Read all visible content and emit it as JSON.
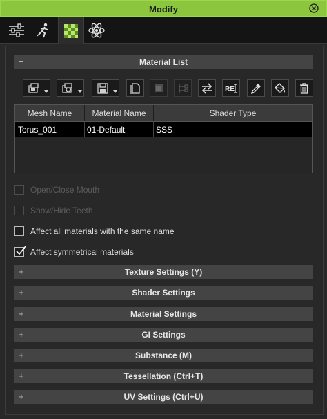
{
  "window": {
    "title": "Modify"
  },
  "tabs": [
    {
      "name": "modify-sliders-tab",
      "icon": "sliders-icon",
      "active": false
    },
    {
      "name": "motion-tab",
      "icon": "running-figure-icon",
      "active": false
    },
    {
      "name": "material-tab",
      "icon": "checker-material-icon",
      "active": true
    },
    {
      "name": "physics-tab",
      "icon": "atom-icon",
      "active": false
    }
  ],
  "material_list": {
    "header_label": "Material List",
    "collapse_symbol": "−",
    "toolbar": [
      {
        "icon": "load-material-icon",
        "dropdown": true,
        "enabled": true
      },
      {
        "icon": "load-texture-icon",
        "dropdown": true,
        "enabled": true
      },
      {
        "icon": "save-material-icon",
        "dropdown": true,
        "enabled": true
      },
      {
        "icon": "duplicate-icon",
        "dropdown": false,
        "enabled": true
      },
      {
        "icon": "texture-editor-icon",
        "dropdown": false,
        "enabled": false
      },
      {
        "icon": "hierarchy-icon",
        "dropdown": false,
        "enabled": false
      },
      {
        "icon": "swap-icon",
        "dropdown": false,
        "enabled": true
      },
      {
        "icon": "rename-icon",
        "dropdown": false,
        "enabled": true,
        "text": "RE"
      },
      {
        "icon": "eyedropper-icon",
        "dropdown": false,
        "enabled": true
      },
      {
        "icon": "paint-bucket-icon",
        "dropdown": false,
        "enabled": true
      },
      {
        "icon": "trash-icon",
        "dropdown": false,
        "enabled": true
      }
    ],
    "columns": [
      "Mesh Name",
      "Material Name",
      "Shader Type"
    ],
    "rows": [
      {
        "mesh": "Torus_001",
        "material": "01-Default",
        "shader": "SSS"
      }
    ]
  },
  "options": {
    "open_close_mouth": {
      "label": "Open/Close Mouth",
      "checked": false,
      "enabled": false
    },
    "show_hide_teeth": {
      "label": "Show/Hide Teeth",
      "checked": false,
      "enabled": false
    },
    "affect_same_name": {
      "label": "Affect all materials with the same name",
      "checked": false,
      "enabled": true
    },
    "affect_symmetrical": {
      "label": "Affect symmetrical materials",
      "checked": true,
      "enabled": true
    }
  },
  "sections": [
    {
      "label": "Texture Settings  (Y)",
      "symbol": "+"
    },
    {
      "label": "Shader Settings",
      "symbol": "+"
    },
    {
      "label": "Material Settings",
      "symbol": "+"
    },
    {
      "label": "GI Settings",
      "symbol": "+"
    },
    {
      "label": "Substance (M)",
      "symbol": "+"
    },
    {
      "label": "Tessellation  (Ctrl+T)",
      "symbol": "+"
    },
    {
      "label": "UV Settings  (Ctrl+U)",
      "symbol": "+"
    }
  ],
  "colors": {
    "accent": "#8cc63e",
    "background": "#282828",
    "section_header": "#444444"
  }
}
